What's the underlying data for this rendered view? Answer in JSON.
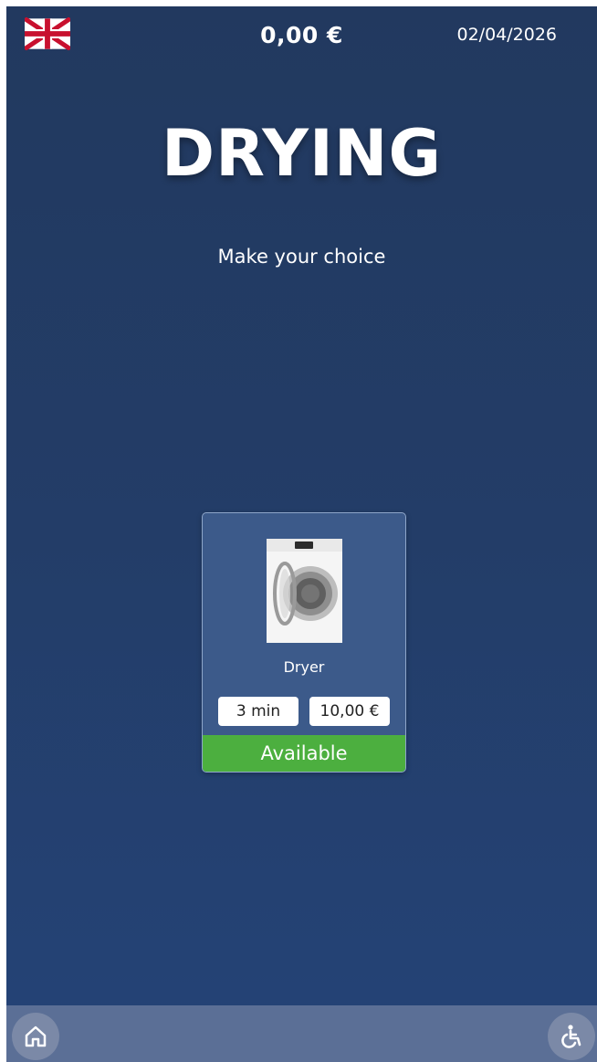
{
  "header": {
    "language_icon": "uk-flag-icon",
    "balance": "0,00 €",
    "date": "02/04/2026"
  },
  "page": {
    "title": "DRYING",
    "subtitle": "Make your choice"
  },
  "machines": [
    {
      "name": "Dryer",
      "image_icon": "dryer-machine-icon",
      "duration": "3 min",
      "price": "10,00 €",
      "status": "Available",
      "status_color": "#4caf3f"
    }
  ],
  "footer": {
    "home_icon": "home-icon",
    "accessibility_icon": "accessibility-icon"
  },
  "colors": {
    "background": "#233d68",
    "card": "#3c5a8a",
    "bottom_bar": "#5b6f96",
    "available": "#4caf3f"
  }
}
